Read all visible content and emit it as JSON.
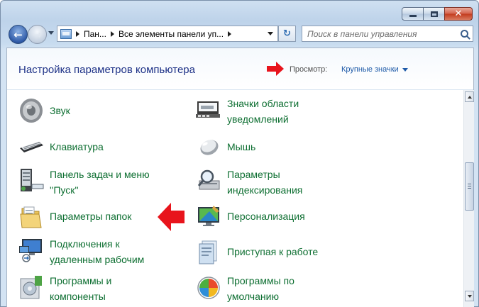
{
  "window": {
    "buttons": {
      "minimize": "minimize",
      "maximize": "maximize",
      "close": "✕"
    }
  },
  "navigation": {
    "back_glyph": "←",
    "forward_glyph": "→",
    "breadcrumb": [
      "Пан...",
      "Все элементы панели уп..."
    ],
    "refresh_glyph": "↻",
    "search_placeholder": "Поиск в панели управления"
  },
  "header": {
    "title": "Настройка параметров компьютера",
    "view_label": "Просмотр:",
    "view_value": "Крупные значки"
  },
  "items": {
    "sound": {
      "label": "Звук",
      "icon": "speaker-icon"
    },
    "notification_icons": {
      "line1": "Значки области",
      "line2": "уведомлений",
      "icon": "notification-area-icon"
    },
    "keyboard": {
      "label": "Клавиатура",
      "icon": "keyboard-icon"
    },
    "mouse": {
      "label": "Мышь",
      "icon": "mouse-icon"
    },
    "taskbar": {
      "line1": "Панель задач и меню",
      "line2": "''Пуск''",
      "icon": "taskbar-icon"
    },
    "indexing": {
      "line1": "Параметры",
      "line2": "индексирования",
      "icon": "indexing-icon"
    },
    "folder_options": {
      "label": "Параметры папок",
      "icon": "folder-options-icon"
    },
    "personalization": {
      "label": "Персонализация",
      "icon": "personalization-icon"
    },
    "remote": {
      "line1": "Подключения к",
      "line2": "удаленным рабочим",
      "icon": "remote-desktop-icon"
    },
    "getting_started": {
      "label": "Приступая к работе",
      "icon": "getting-started-icon"
    },
    "programs": {
      "line1": "Программы и",
      "line2": "компоненты",
      "icon": "programs-icon"
    },
    "default_programs": {
      "line1": "Программы по",
      "line2": "умолчанию",
      "icon": "default-programs-icon"
    }
  },
  "colors": {
    "link_green": "#0e6f32",
    "title_blue": "#1e3287",
    "annotation_red": "#e8141c"
  }
}
